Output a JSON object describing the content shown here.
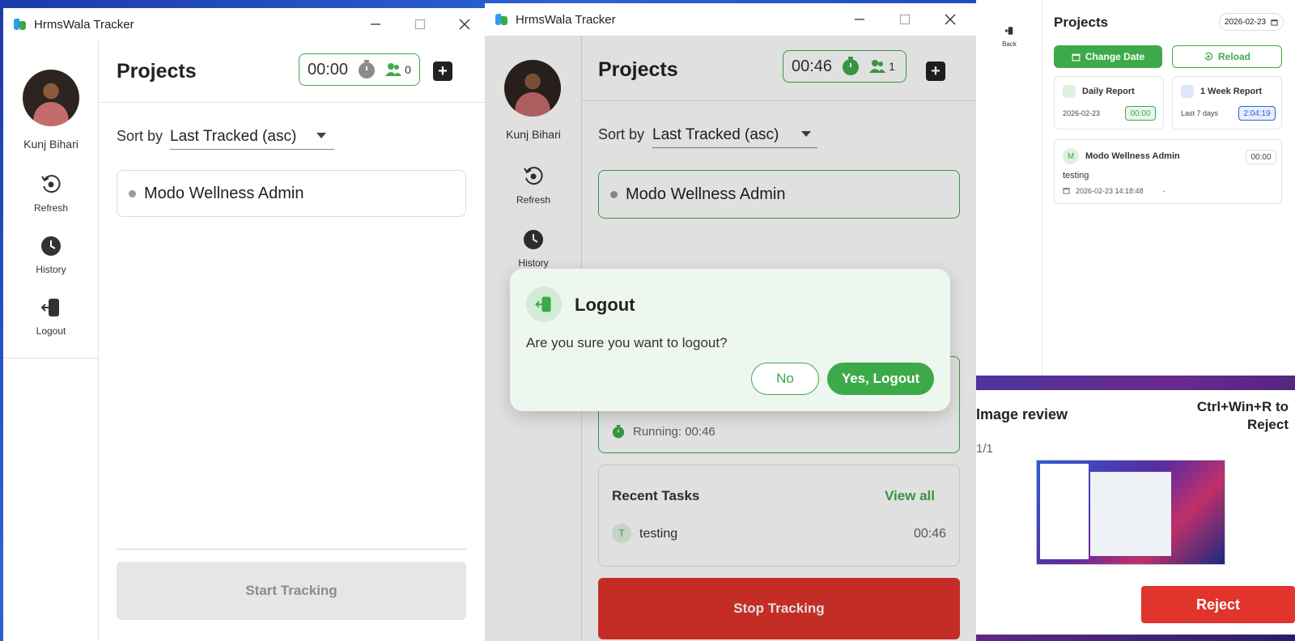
{
  "win1": {
    "title": "HrmsWala Tracker",
    "user": "Kunj Bihari",
    "nav": {
      "refresh": "Refresh",
      "history": "History",
      "logout": "Logout"
    },
    "heading": "Projects",
    "timer": "00:00",
    "members": "0",
    "sort_label": "Sort by",
    "sort_value": "Last Tracked (asc)",
    "project": "Modo Wellness Admin",
    "start_button": "Start Tracking"
  },
  "win2": {
    "title": "HrmsWala Tracker",
    "user": "Kunj Bihari",
    "nav": {
      "refresh": "Refresh",
      "history": "History"
    },
    "heading": "Projects",
    "timer": "00:46",
    "members": "1",
    "sort_label": "Sort by",
    "sort_value": "Last Tracked (asc)",
    "project": "Modo Wellness Admin",
    "running": "Running: 00:46",
    "recent_title": "Recent Tasks",
    "view_all": "View all",
    "task": {
      "avatar": "T",
      "name": "testing",
      "time": "00:46"
    },
    "stop_button": "Stop Tracking"
  },
  "logout_dialog": {
    "title": "Logout",
    "message": "Are you sure you want to logout?",
    "no": "No",
    "yes": "Yes, Logout"
  },
  "panel3": {
    "back": "Back",
    "heading": "Projects",
    "date": "2026-02-23",
    "change_date": "Change Date",
    "reload": "Reload",
    "daily": {
      "title": "Daily Report",
      "date": "2026-02-23",
      "value": "00:00"
    },
    "weekly": {
      "title": "1 Week Report",
      "range": "Last 7 days",
      "value": "2:04:19"
    },
    "entry": {
      "avatar": "M",
      "project": "Modo Wellness Admin",
      "time": "00:00",
      "task": "testing",
      "timestamp": "2026-02-23 14:18:48",
      "dash": "-"
    }
  },
  "review": {
    "title": "Image review",
    "shortcut": "Ctrl+Win+R to Reject",
    "count": "1/1",
    "reject": "Reject"
  },
  "colors": {
    "green": "#3daa4a",
    "red": "#e0342c",
    "blue_accent": "#2a63d8"
  }
}
